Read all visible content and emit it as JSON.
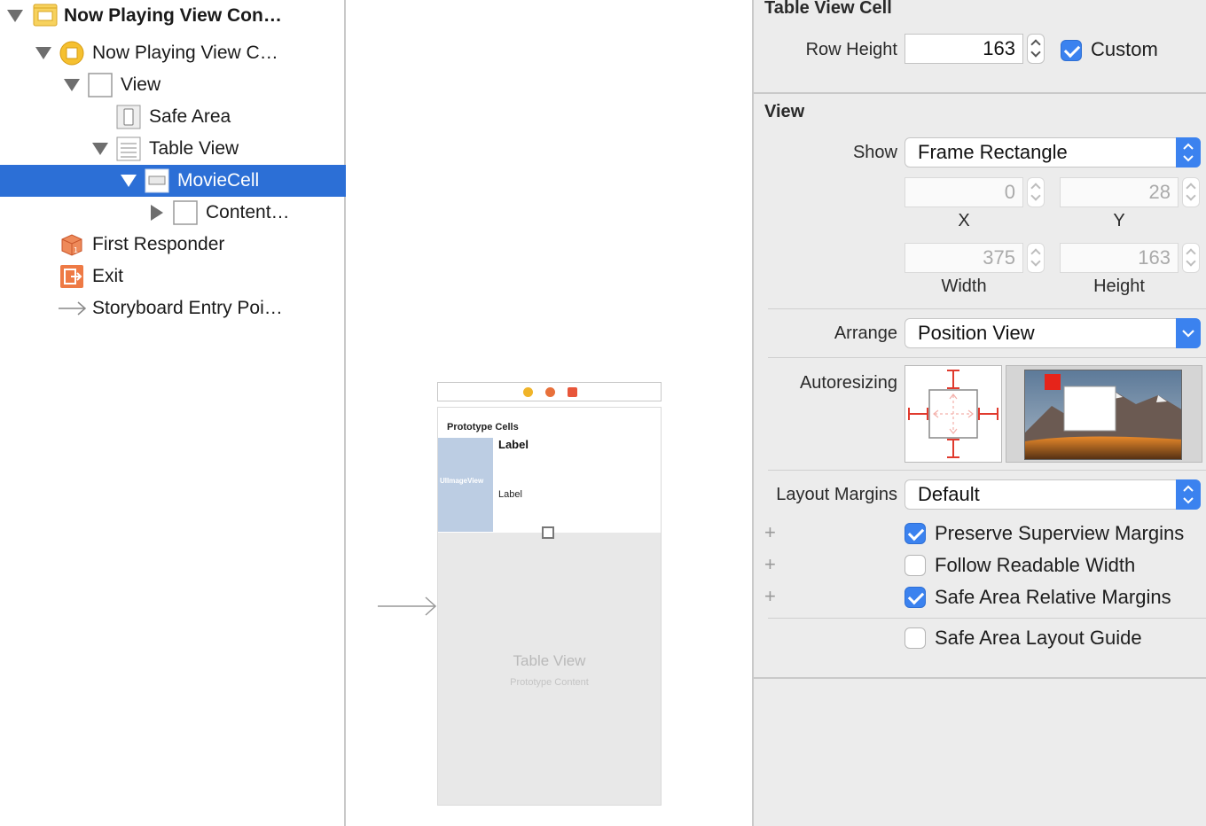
{
  "outline": {
    "items": [
      {
        "label": "Now Playing View Con…",
        "icon": "scene-icon",
        "expanded": true
      },
      {
        "label": "Now Playing View C…",
        "icon": "view-controller-icon",
        "expanded": true
      },
      {
        "label": "View",
        "icon": "view-icon",
        "expanded": true
      },
      {
        "label": "Safe Area",
        "icon": "safe-area-icon"
      },
      {
        "label": "Table View",
        "icon": "table-view-icon",
        "expanded": true
      },
      {
        "label": "MovieCell",
        "icon": "table-cell-icon",
        "expanded": true,
        "selected": true
      },
      {
        "label": "Content…",
        "icon": "content-view-icon",
        "expanded": false
      },
      {
        "label": "First Responder",
        "icon": "first-responder-icon"
      },
      {
        "label": "Exit",
        "icon": "exit-icon"
      },
      {
        "label": "Storyboard Entry Poi…",
        "icon": "entry-arrow-icon"
      }
    ]
  },
  "canvas": {
    "prototype_cells": "Prototype Cells",
    "image_view": "UIImageView",
    "label_title": "Label",
    "label_sub": "Label",
    "table_view_title": "Table View",
    "table_view_sub": "Prototype Content",
    "dot_colors": [
      "#f0b429",
      "#e8703a",
      "#e8563a"
    ]
  },
  "inspector": {
    "cell_section": "Table View Cell",
    "row_height_label": "Row Height",
    "row_height_value": "163",
    "custom_label": "Custom",
    "custom_checked": true,
    "view_section": "View",
    "show_label": "Show",
    "show_value": "Frame Rectangle",
    "x_value": "0",
    "y_value": "28",
    "x_caption": "X",
    "y_caption": "Y",
    "width_value": "375",
    "height_value": "163",
    "width_caption": "Width",
    "height_caption": "Height",
    "arrange_label": "Arrange",
    "arrange_value": "Position View",
    "autoresizing_label": "Autoresizing",
    "layout_margins_label": "Layout Margins",
    "layout_margins_value": "Default",
    "preserve_label": "Preserve Superview Margins",
    "preserve_checked": true,
    "readable_label": "Follow Readable Width",
    "readable_checked": false,
    "safe_margins_label": "Safe Area Relative Margins",
    "safe_margins_checked": true,
    "safe_guide_label": "Safe Area Layout Guide",
    "safe_guide_checked": false,
    "plus": "+",
    "accent_color": "#3b82ef"
  }
}
